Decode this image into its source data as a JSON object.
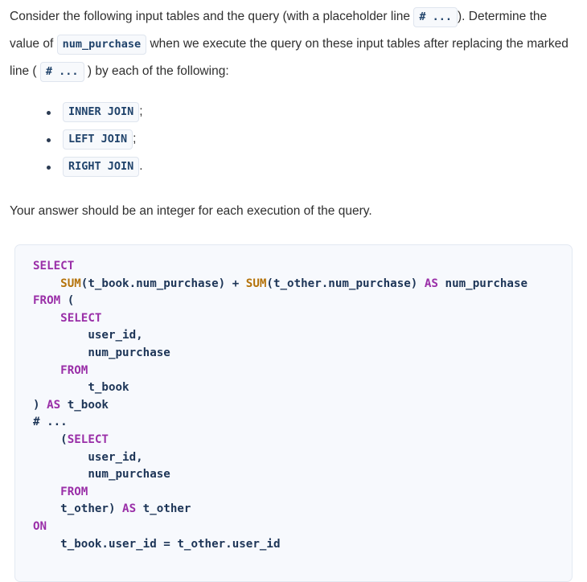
{
  "paragraphs": {
    "intro_part1": "Consider the following input tables and the query (with a placeholder line ",
    "intro_code1": "# ...",
    "intro_part2": ").",
    "determine_part1": "Determine the value of ",
    "determine_code": "num_purchase",
    "determine_part2": " when we execute the query on these input tables after replacing the marked line ( ",
    "determine_code2": "# ...",
    "determine_part3": " ) by each of the following:",
    "answer_note": "Your answer should be an integer for each execution of the query."
  },
  "join_list": [
    {
      "code": "INNER JOIN",
      "tail": ";"
    },
    {
      "code": "LEFT JOIN",
      "tail": ";"
    },
    {
      "code": "RIGHT JOIN",
      "tail": "."
    }
  ],
  "code_block": {
    "language": "sql",
    "lines": [
      [
        {
          "t": "SELECT",
          "c": "kw"
        }
      ],
      [
        {
          "t": "    ",
          "c": "pl"
        },
        {
          "t": "SUM",
          "c": "fn"
        },
        {
          "t": "(t_book.num_purchase) + ",
          "c": "pl"
        },
        {
          "t": "SUM",
          "c": "fn"
        },
        {
          "t": "(t_other.num_purchase) ",
          "c": "pl"
        },
        {
          "t": "AS",
          "c": "kw"
        },
        {
          "t": " num_purchase",
          "c": "pl"
        }
      ],
      [
        {
          "t": "FROM",
          "c": "kw"
        },
        {
          "t": " (",
          "c": "pl"
        }
      ],
      [
        {
          "t": "    ",
          "c": "pl"
        },
        {
          "t": "SELECT",
          "c": "kw"
        }
      ],
      [
        {
          "t": "        user_id,",
          "c": "pl"
        }
      ],
      [
        {
          "t": "        num_purchase",
          "c": "pl"
        }
      ],
      [
        {
          "t": "    ",
          "c": "pl"
        },
        {
          "t": "FROM",
          "c": "kw"
        }
      ],
      [
        {
          "t": "        t_book",
          "c": "pl"
        }
      ],
      [
        {
          "t": ") ",
          "c": "pl"
        },
        {
          "t": "AS",
          "c": "kw"
        },
        {
          "t": " t_book",
          "c": "pl"
        }
      ],
      [
        {
          "t": "# ...",
          "c": "pl"
        }
      ],
      [
        {
          "t": "    (",
          "c": "pl"
        },
        {
          "t": "SELECT",
          "c": "kw"
        }
      ],
      [
        {
          "t": "        user_id,",
          "c": "pl"
        }
      ],
      [
        {
          "t": "        num_purchase",
          "c": "pl"
        }
      ],
      [
        {
          "t": "    ",
          "c": "pl"
        },
        {
          "t": "FROM",
          "c": "kw"
        }
      ],
      [
        {
          "t": "    t_other) ",
          "c": "pl"
        },
        {
          "t": "AS",
          "c": "kw"
        },
        {
          "t": " t_other",
          "c": "pl"
        }
      ],
      [
        {
          "t": "ON",
          "c": "kw"
        }
      ],
      [
        {
          "t": "    t_book.user_id = t_other.user_id",
          "c": "pl"
        }
      ]
    ]
  },
  "colors": {
    "page_background": "#ffffff",
    "body_text": "#2f2f2f",
    "code_background": "#f7f9fd",
    "code_border": "#e3e9f2",
    "code_plain": "#1d3557",
    "code_keyword": "#9a2fa8",
    "code_function": "#b5730b",
    "inline_code_text": "#20436b",
    "inline_code_background": "#f7f9fc",
    "inline_code_border": "#dfe5ee"
  }
}
